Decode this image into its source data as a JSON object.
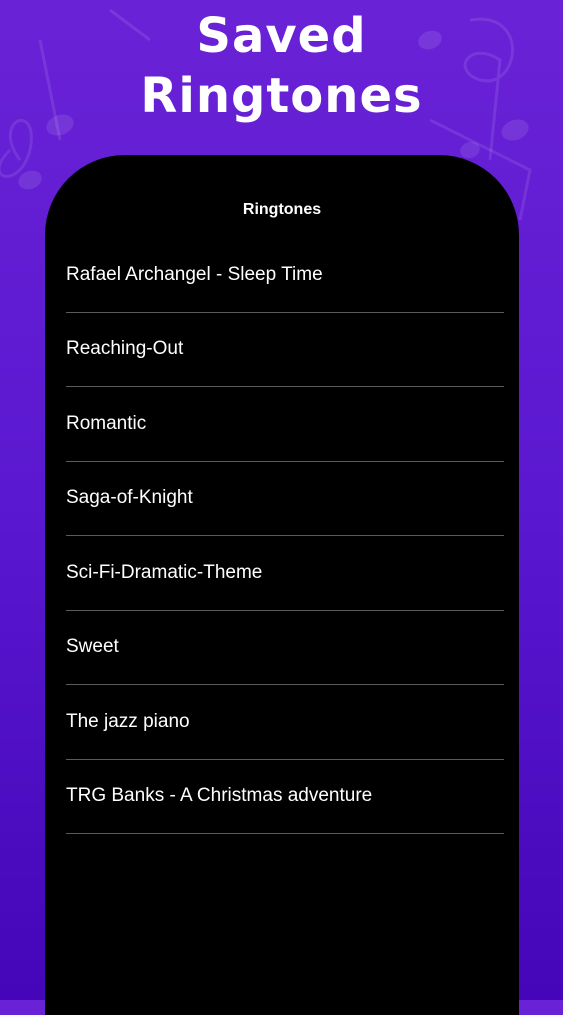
{
  "hero": {
    "title_line1": "Saved",
    "title_line2": "Ringtones"
  },
  "screen": {
    "nav_title": "Ringtones",
    "ringtones": [
      "Rafael Archangel - Sleep Time",
      "Reaching-Out",
      "Romantic",
      "Saga-of-Knight",
      "Sci-Fi-Dramatic-Theme",
      "Sweet",
      "The jazz piano",
      "TRG Banks - A Christmas adventure"
    ]
  },
  "colors": {
    "background_top": "#6a22d6",
    "background_bottom": "#4406b8",
    "screen_bg": "#000000",
    "separator": "#5a5a5e",
    "text": "#ffffff"
  }
}
